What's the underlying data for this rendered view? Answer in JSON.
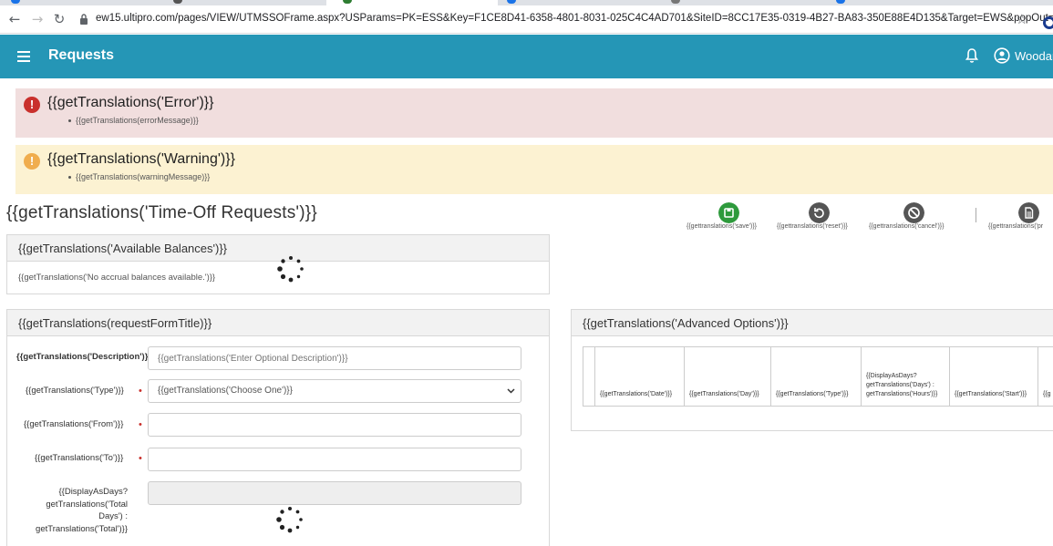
{
  "browser": {
    "url": "ew15.ultipro.com/pages/VIEW/UTMSSOFrame.aspx?USParams=PK=ESS&Key=F1CE8D41-6358-4801-8031-025C4C4AD701&SiteID=8CC17E35-0319-4B27-BA83-350E88E4D135&Target=EWS&popOut=true"
  },
  "header": {
    "title": "Requests",
    "user_name": "Woodar"
  },
  "alerts": {
    "error": {
      "title": "{{getTranslations('Error')}}",
      "message": "{{getTranslations(errorMessage)}}"
    },
    "warning": {
      "title": "{{getTranslations('Warning')}}",
      "message": "{{getTranslations(warningMessage)}}"
    }
  },
  "page": {
    "title": "{{getTranslations('Time-Off Requests')}}"
  },
  "toolbar": {
    "save_label": "{{gettranslations('save')}}",
    "reset_label": "{{gettranslations('reset')}}",
    "cancel_label": "{{gettranslations('cancel')}}",
    "print_label": "{{gettranslations('pr",
    "colors": {
      "save": "#2e9a3c",
      "reset": "#555555",
      "cancel": "#555555",
      "print": "#555555"
    }
  },
  "balances": {
    "title": "{{getTranslations('Available Balances')}}",
    "message": "{{getTranslations('No accrual balances available.')}}"
  },
  "request_form": {
    "title": "{{getTranslations(requestFormTitle)}}",
    "description_label": "{{getTranslations('Description')}}",
    "description_placeholder": "{{getTranslations('Enter Optional Description')}}",
    "type_label": "{{getTranslations('Type')}}",
    "type_selected": "{{getTranslations('Choose One')}}",
    "from_label": "{{getTranslations('From')}}",
    "to_label": "{{getTranslations('To')}}",
    "total_label_lines": [
      "{{DisplayAsDays?",
      "getTranslations('Total",
      "Days') :",
      "getTranslations('Total')}}"
    ],
    "required_mark": "•"
  },
  "advanced": {
    "title": "{{getTranslations('Advanced Options')}}",
    "columns": [
      {
        "lines": [
          ""
        ]
      },
      {
        "lines": [
          "{{getTranslations('Date')}}"
        ]
      },
      {
        "lines": [
          "{{getTranslations('Day')}}"
        ]
      },
      {
        "lines": [
          "{{getTranslations('Type')}}"
        ]
      },
      {
        "lines": [
          "{{DisplayAsDays?",
          "getTranslations('Days') :",
          "getTranslations('Hours')}}"
        ]
      },
      {
        "lines": [
          "{{getTranslations('Start')}}"
        ]
      },
      {
        "lines": [
          "{{g"
        ]
      }
    ]
  }
}
